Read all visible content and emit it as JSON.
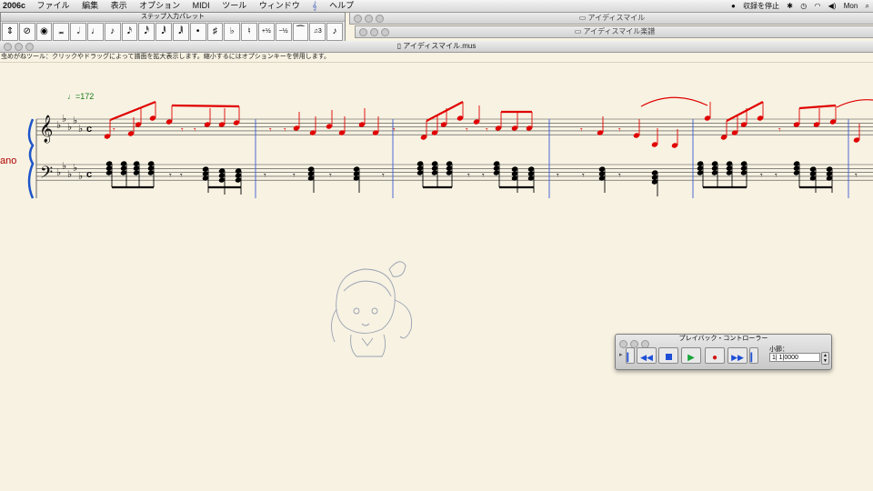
{
  "menubar": {
    "app": "2006c",
    "items": [
      "ファイル",
      "編集",
      "表示",
      "オプション",
      "MIDI",
      "ツール",
      "ウィンドウ",
      "𝄞",
      "ヘルプ"
    ],
    "status_recording": "収録を停止",
    "time": "Mon"
  },
  "palette": {
    "title": "ステップ入力パレット"
  },
  "bgwindows": {
    "win1_title": "アイディスマイル",
    "win2_title": "アイディスマイル楽譜"
  },
  "doc": {
    "title": "アイディスマイル.mus",
    "hint": "虫めがねツール：クリックやドラッグによって譜面を拡大表示します。縮小するにはオプションキーを併用します。"
  },
  "score": {
    "tempo": "=172",
    "instrument": "ano",
    "colors": {
      "right_hand": "#e00000",
      "left_hand": "#000000",
      "barline": "#3b5bd6"
    }
  },
  "playback": {
    "title": "プレイバック・コントローラー",
    "measure_label": "小節：",
    "measure_value": "1| 1|0000",
    "buttons": [
      "rewind-start",
      "rewind",
      "stop",
      "play",
      "record",
      "fast-forward",
      "forward-end"
    ]
  }
}
